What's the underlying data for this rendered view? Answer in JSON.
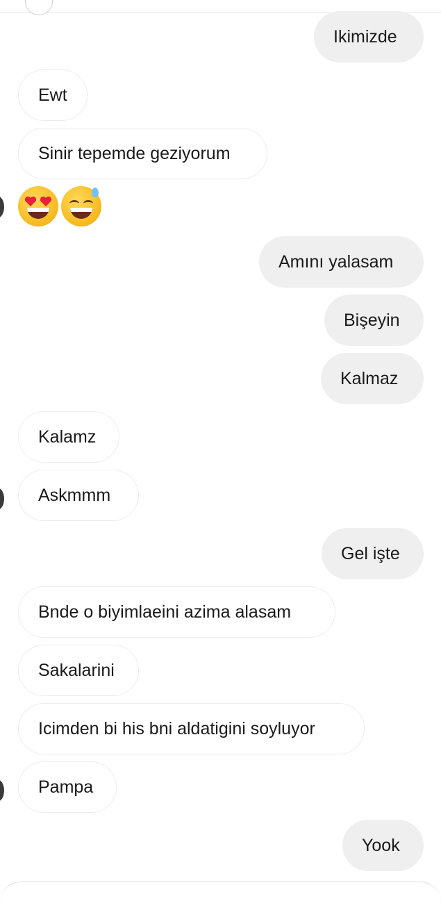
{
  "messages": [
    {
      "side": "out",
      "text": "Ikimizde"
    },
    {
      "side": "in",
      "text": "Ewt"
    },
    {
      "side": "in",
      "text": "Sinir tepemde geziyorum"
    },
    {
      "side": "out",
      "text": "Amını yalasam"
    },
    {
      "side": "out",
      "text": "Bişeyin"
    },
    {
      "side": "out",
      "text": "Kalmaz"
    },
    {
      "side": "in",
      "text": "Kalamz"
    },
    {
      "side": "in",
      "text": "Askmmm"
    },
    {
      "side": "out",
      "text": "Gel işte"
    },
    {
      "side": "in",
      "text": "Bnde o biyimlaeini azima alasam"
    },
    {
      "side": "in",
      "text": "Sakalarini"
    },
    {
      "side": "in",
      "text": "Icimden bi his bni aldatigini soyluyor"
    },
    {
      "side": "in",
      "text": "Pampa"
    },
    {
      "side": "out",
      "text": "Yook"
    }
  ],
  "emoji_message": [
    "smiling-face-with-heart-eyes-icon",
    "grinning-face-with-sweat-icon"
  ],
  "colors": {
    "outgoing_bubble": "#efefef",
    "incoming_border": "#ececec",
    "text": "#1a1a1a"
  }
}
